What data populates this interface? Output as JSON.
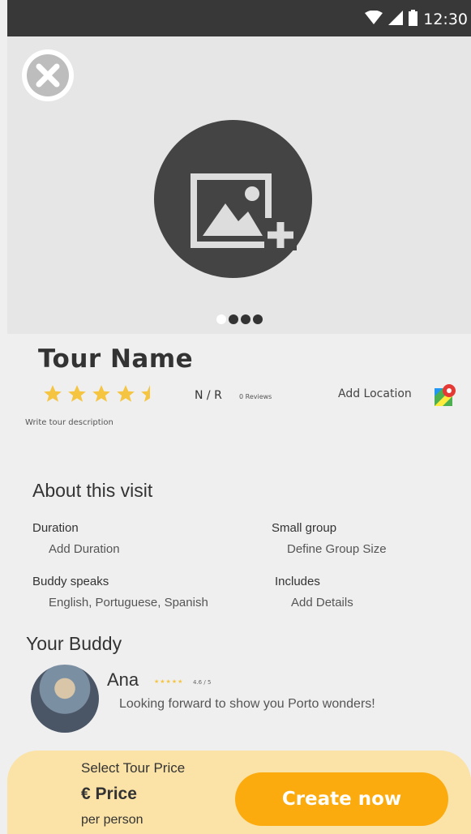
{
  "status_bar": {
    "time": "12:30",
    "icons": [
      "wifi-icon",
      "signal-icon",
      "battery-icon"
    ]
  },
  "hero": {
    "close_icon": "close-icon",
    "add_photo_icon": "add-photo-icon",
    "carousel": {
      "total": 4,
      "active_index": 0
    }
  },
  "tour": {
    "name": "Tour Name",
    "stars": 4.5,
    "rating_text": "N / R",
    "reviews_text": "0 Reviews",
    "add_location_label": "Add Location",
    "description_placeholder": "Write tour description"
  },
  "about": {
    "title": "About this visit",
    "items": [
      {
        "label": "Duration",
        "value": "Add Duration"
      },
      {
        "label": "Small group",
        "value": "Define Group Size"
      },
      {
        "label": "Buddy speaks",
        "value": "English, Portuguese, Spanish"
      },
      {
        "label": "Includes",
        "value": "Add Details"
      }
    ]
  },
  "buddy": {
    "title": "Your Buddy",
    "name": "Ana",
    "stars_text": "★★★★★",
    "rating": "4.6 / 5",
    "message": "Looking forward to show you Porto wonders!"
  },
  "footer": {
    "price_label": "Select Tour Price",
    "price_value": "€ Price",
    "per_person": "per person",
    "create_button": "Create now"
  },
  "colors": {
    "accent": "#fbab0d",
    "footer_bg": "#fbe2a6",
    "star": "#f5c542",
    "status_bar": "#383838"
  }
}
